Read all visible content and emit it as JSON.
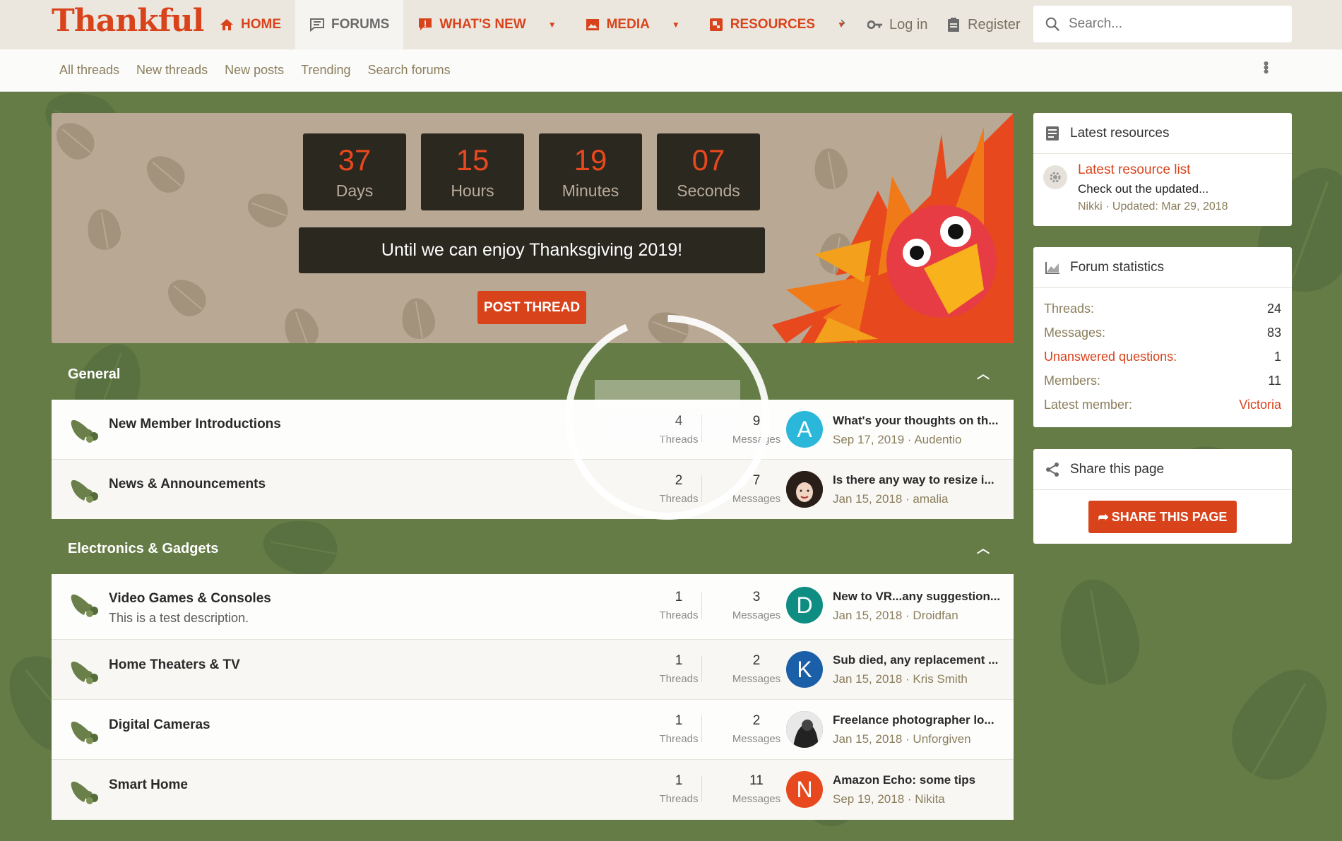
{
  "header": {
    "logo": "Thankful",
    "nav": [
      {
        "label": "Home",
        "icon": "home-icon"
      },
      {
        "label": "Forums",
        "icon": "forum-icon",
        "active": true
      },
      {
        "label": "What's new",
        "icon": "alert-icon"
      },
      {
        "label": "Media",
        "icon": "image-icon"
      },
      {
        "label": "Resources",
        "icon": "resources-icon"
      }
    ],
    "login_label": "Log in",
    "register_label": "Register",
    "search_placeholder": "Search..."
  },
  "subnav": {
    "items": [
      "All threads",
      "New threads",
      "New posts",
      "Trending",
      "Search forums"
    ]
  },
  "banner": {
    "countdown": [
      {
        "value": "37",
        "label": "Days"
      },
      {
        "value": "15",
        "label": "Hours"
      },
      {
        "value": "19",
        "label": "Minutes"
      },
      {
        "value": "07",
        "label": "Seconds"
      }
    ],
    "until_text": "Until we can enjoy Thanksgiving 2019!",
    "post_thread_label": "Post thread"
  },
  "categories": [
    {
      "title": "General",
      "forums": [
        {
          "title": "New Member Introductions",
          "desc": "",
          "threads": "4",
          "threads_label": "Threads",
          "messages": "9",
          "messages_label": "Messages",
          "last_title": "What's your thoughts on th...",
          "last_meta": "Sep 17, 2019 · Audentio",
          "avatar_letter": "A",
          "avatar_color": "#2ab7d9"
        },
        {
          "title": "News & Announcements",
          "desc": "",
          "threads": "2",
          "threads_label": "Threads",
          "messages": "7",
          "messages_label": "Messages",
          "last_title": "Is there any way to resize i...",
          "last_meta": "Jan 15, 2018 · amalia",
          "avatar_letter": "",
          "avatar_color": "#3a2b24"
        }
      ]
    },
    {
      "title": "Electronics & Gadgets",
      "forums": [
        {
          "title": "Video Games & Consoles",
          "desc": "This is a test description.",
          "threads": "1",
          "threads_label": "Threads",
          "messages": "3",
          "messages_label": "Messages",
          "last_title": "New to VR...any suggestion...",
          "last_meta": "Jan 15, 2018 · Droidfan",
          "avatar_letter": "D",
          "avatar_color": "#0e8d82"
        },
        {
          "title": "Home Theaters & TV",
          "desc": "",
          "threads": "1",
          "threads_label": "Threads",
          "messages": "2",
          "messages_label": "Messages",
          "last_title": "Sub died, any replacement ...",
          "last_meta": "Jan 15, 2018 · Kris Smith",
          "avatar_letter": "K",
          "avatar_color": "#1a5fa8"
        },
        {
          "title": "Digital Cameras",
          "desc": "",
          "threads": "1",
          "threads_label": "Threads",
          "messages": "2",
          "messages_label": "Messages",
          "last_title": "Freelance photographer lo...",
          "last_meta": "Jan 15, 2018 · Unforgiven",
          "avatar_letter": "",
          "avatar_color": "#4a4a4a"
        },
        {
          "title": "Smart Home",
          "desc": "",
          "threads": "1",
          "threads_label": "Threads",
          "messages": "11",
          "messages_label": "Messages",
          "last_title": "Amazon Echo: some tips",
          "last_meta": "Sep 19, 2018 · Nikita",
          "avatar_letter": "N",
          "avatar_color": "#e8481d"
        }
      ]
    }
  ],
  "sidebar": {
    "resources": {
      "title": "Latest resources",
      "item_title": "Latest resource list",
      "item_desc": "Check out the updated...",
      "item_meta": "Nikki · Updated: Mar 29, 2018"
    },
    "stats": {
      "title": "Forum statistics",
      "rows": [
        {
          "k": "Threads:",
          "v": "24"
        },
        {
          "k": "Messages:",
          "v": "83"
        },
        {
          "k": "Unanswered questions:",
          "v": "1"
        },
        {
          "k": "Members:",
          "v": "11"
        },
        {
          "k": "Latest member:",
          "v": "Victoria"
        }
      ]
    },
    "share": {
      "title": "Share this page",
      "button": "Share this page"
    }
  },
  "colors": {
    "accent": "#d9431b",
    "background": "#667c47",
    "banner": "#b9a894"
  }
}
